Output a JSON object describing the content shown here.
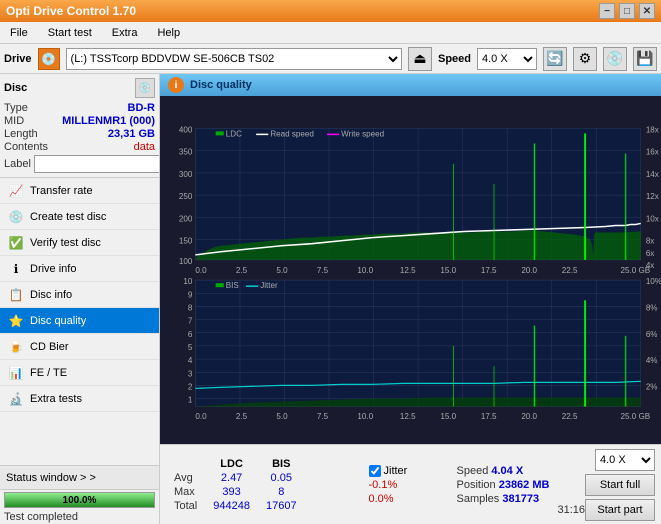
{
  "titlebar": {
    "title": "Opti Drive Control 1.70",
    "minimize": "−",
    "maximize": "□",
    "close": "✕"
  },
  "menubar": {
    "items": [
      "File",
      "Start test",
      "Extra",
      "Help"
    ]
  },
  "drivebar": {
    "label": "Drive",
    "drive_value": "(L:)  TSSTcorp BDDVDW SE-506CB TS02",
    "speed_label": "Speed",
    "speed_value": "4.0 X"
  },
  "disc": {
    "title": "Disc",
    "type_label": "Type",
    "type_value": "BD-R",
    "mid_label": "MID",
    "mid_value": "MILLENMR1 (000)",
    "length_label": "Length",
    "length_value": "23,31 GB",
    "contents_label": "Contents",
    "contents_value": "data",
    "label_label": "Label",
    "label_placeholder": ""
  },
  "nav": {
    "items": [
      {
        "id": "transfer-rate",
        "label": "Transfer rate",
        "icon": "📈"
      },
      {
        "id": "create-test-disc",
        "label": "Create test disc",
        "icon": "💿"
      },
      {
        "id": "verify-test-disc",
        "label": "Verify test disc",
        "icon": "✅"
      },
      {
        "id": "drive-info",
        "label": "Drive info",
        "icon": "ℹ️"
      },
      {
        "id": "disc-info",
        "label": "Disc info",
        "icon": "📋"
      },
      {
        "id": "disc-quality",
        "label": "Disc quality",
        "icon": "⭐",
        "active": true
      },
      {
        "id": "cd-bier",
        "label": "CD Bier",
        "icon": "🍺"
      },
      {
        "id": "fe-te",
        "label": "FE / TE",
        "icon": "📊"
      },
      {
        "id": "extra-tests",
        "label": "Extra tests",
        "icon": "🔬"
      }
    ]
  },
  "status": {
    "window_label": "Status window > >",
    "progress": 100,
    "progress_text": "100.0%",
    "completed_text": "Test completed"
  },
  "disc_quality": {
    "title": "Disc quality",
    "legend": {
      "ldc": "LDC",
      "read_speed": "Read speed",
      "write_speed": "Write speed",
      "bis": "BIS",
      "jitter": "Jitter"
    }
  },
  "stats": {
    "headers": [
      "LDC",
      "BIS",
      "",
      "Jitter",
      "Speed",
      "4.04 X"
    ],
    "avg_label": "Avg",
    "avg_ldc": "2.47",
    "avg_bis": "0.05",
    "avg_jitter": "-0.1%",
    "max_label": "Max",
    "max_ldc": "393",
    "max_bis": "8",
    "max_jitter": "0.0%",
    "total_label": "Total",
    "total_ldc": "944248",
    "total_bis": "17607",
    "position_label": "Position",
    "position_value": "23862 MB",
    "samples_label": "Samples",
    "samples_value": "381773",
    "speed_selector": "4.0 X",
    "start_full_label": "Start full",
    "start_part_label": "Start part",
    "time": "31:16"
  }
}
